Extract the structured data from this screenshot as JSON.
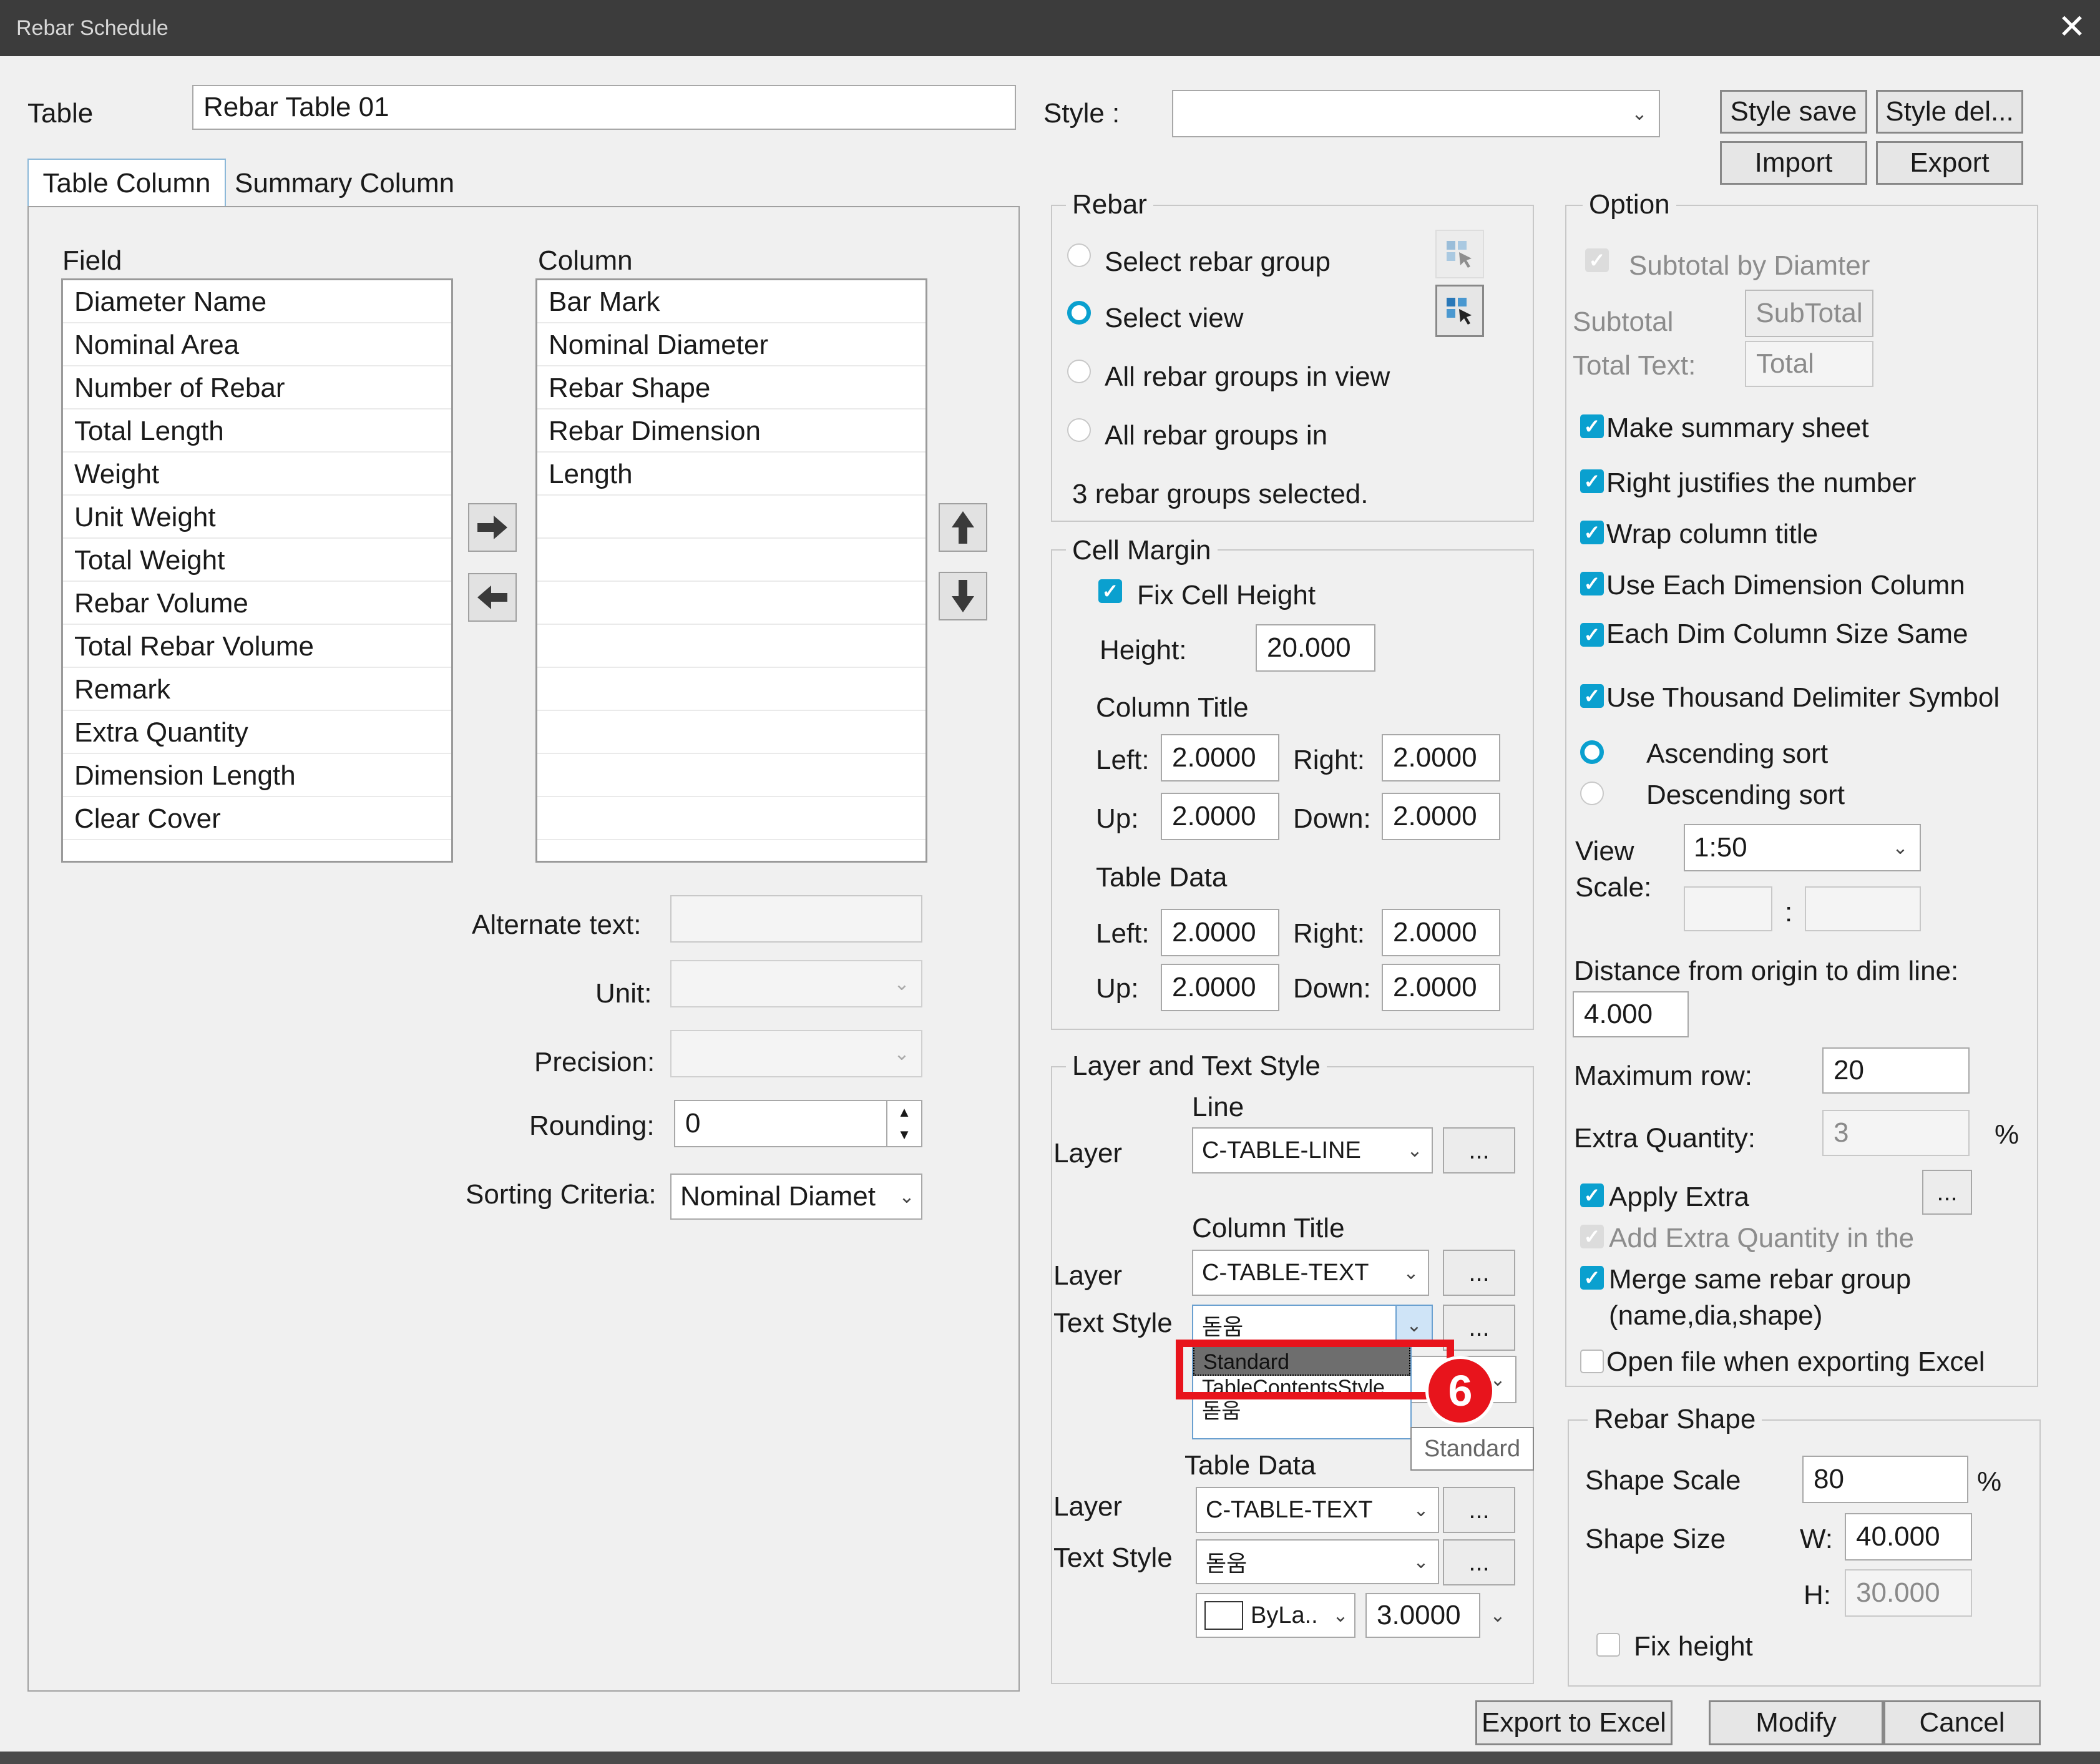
{
  "window": {
    "title": "Rebar Schedule",
    "close": "✕"
  },
  "table": {
    "label": "Table",
    "name": "Rebar Table 01"
  },
  "style": {
    "label": "Style :",
    "value": ""
  },
  "buttons": {
    "style_save": "Style save",
    "style_del": "Style del...",
    "import": "Import",
    "export": "Export",
    "export_excel": "Export to Excel",
    "modify": "Modify",
    "cancel": "Cancel",
    "dots": "..."
  },
  "tabs": [
    {
      "label": "Table Column"
    },
    {
      "label": "Summary Column"
    }
  ],
  "field": {
    "label": "Field",
    "items": [
      "Diameter Name",
      "Nominal Area",
      "Number of Rebar",
      "Total Length",
      "Weight",
      "Unit Weight",
      "Total Weight",
      "Rebar Volume",
      "Total Rebar Volume",
      "Remark",
      "Extra Quantity",
      "Dimension Length",
      "Clear Cover"
    ]
  },
  "column": {
    "label": "Column",
    "items": [
      "Bar Mark",
      "Nominal Diameter",
      "Rebar Shape",
      "Rebar Dimension",
      "Length"
    ]
  },
  "props": {
    "alt_text_label": "Alternate text:",
    "alt_text": "",
    "unit_label": "Unit:",
    "precision_label": "Precision:",
    "rounding_label": "Rounding:",
    "rounding": "0",
    "sorting_label": "Sorting Criteria:",
    "sorting": "Nominal Diamet"
  },
  "rebar": {
    "legend": "Rebar",
    "options": [
      "Select rebar group",
      "Select view",
      "All rebar groups in view",
      "All rebar groups in"
    ],
    "selected_index": 1,
    "status": "3 rebar groups selected."
  },
  "cell_margin": {
    "legend": "Cell Margin",
    "fix_height": "Fix Cell Height",
    "height_label": "Height:",
    "height": "20.000",
    "column_title": "Column Title",
    "table_data": "Table Data",
    "left_label": "Left:",
    "right_label": "Right:",
    "up_label": "Up:",
    "down_label": "Down:",
    "ct_left": "2.0000",
    "ct_right": "2.0000",
    "ct_up": "2.0000",
    "ct_down": "2.0000",
    "td_left": "2.0000",
    "td_right": "2.0000",
    "td_up": "2.0000",
    "td_down": "2.0000"
  },
  "layer_text": {
    "legend": "Layer and Text Style",
    "line": "Line",
    "layer_label": "Layer",
    "text_style_label": "Text Style",
    "line_layer": "C-TABLE-LINE",
    "column_title": "Column Title",
    "ct_layer": "C-TABLE-TEXT",
    "ct_text_style": "돋움",
    "dropdown_items": [
      "Standard",
      "TableContentsStyle",
      "돋움"
    ],
    "tooltip": "Standard",
    "table_data": "Table Data",
    "td_layer": "C-TABLE-TEXT",
    "td_text_style": "돋움",
    "color": "ByLa..",
    "text_height": "3.0000"
  },
  "option": {
    "legend": "Option",
    "subtotal_by": "Subtotal by Diamter",
    "subtotal_label": "Subtotal",
    "subtotal_btn": "SubTotal",
    "total_text_label": "Total Text:",
    "total_text": "Total",
    "checks": [
      "Make summary sheet",
      "Right justifies the number",
      "Wrap column title",
      "Use Each Dimension Column",
      "Each Dim Column Size Same",
      "Use Thousand Delimiter Symbol"
    ],
    "ascending": "Ascending sort",
    "descending": "Descending sort",
    "view_label": "View",
    "scale_label": "Scale:",
    "view_scale": "1:50",
    "colon": ":",
    "distance_label": "Distance from origin to dim line:",
    "distance": "4.000",
    "max_row_label": "Maximum row:",
    "max_row": "20",
    "extra_qty_label": "Extra Quantity:",
    "extra_qty": "3",
    "percent": "%",
    "apply_extra": "Apply Extra",
    "add_extra": "Add Extra Quantity in the",
    "merge": "Merge same rebar group",
    "merge2": "(name,dia,shape)",
    "open_file": "Open file when exporting Excel"
  },
  "rebar_shape": {
    "legend": "Rebar Shape",
    "scale_label": "Shape Scale",
    "scale": "80",
    "percent": "%",
    "size_label": "Shape Size",
    "w_label": "W:",
    "w": "40.000",
    "h_label": "H:",
    "h": "30.000",
    "fix_height": "Fix height"
  },
  "annotation": {
    "step": "6"
  },
  "colors": {
    "accent": "#0aa0cf",
    "highlight": "#e8141c",
    "titlebar": "#3c3c3c"
  }
}
